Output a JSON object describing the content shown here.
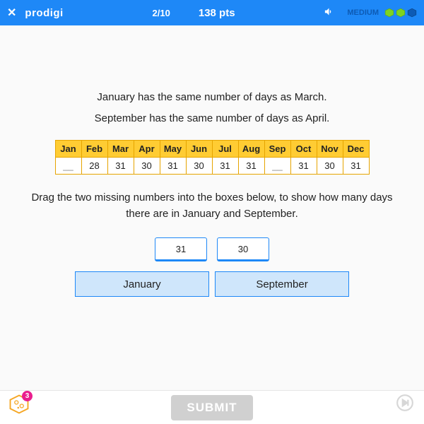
{
  "header": {
    "logo": "prodigi",
    "progress": "2/10",
    "points": "138 pts",
    "difficulty": "MEDIUM",
    "hex_colors": [
      "#7ed321",
      "#7ed321",
      "#0d5bb5"
    ]
  },
  "question": {
    "line1": "January has the same number of days as March.",
    "line2": "September has the same number of days as April.",
    "months": [
      "Jan",
      "Feb",
      "Mar",
      "Apr",
      "May",
      "Jun",
      "Jul",
      "Aug",
      "Sep",
      "Oct",
      "Nov",
      "Dec"
    ],
    "days": [
      "__",
      "28",
      "31",
      "30",
      "31",
      "30",
      "31",
      "31",
      "__",
      "31",
      "30",
      "31"
    ],
    "instruction": "Drag the two missing numbers into the boxes below, to show how many days there are in January and September."
  },
  "draggables": [
    "31",
    "30"
  ],
  "dropzones": [
    "January",
    "September"
  ],
  "submit_label": "SUBMIT",
  "badge_count": "3"
}
